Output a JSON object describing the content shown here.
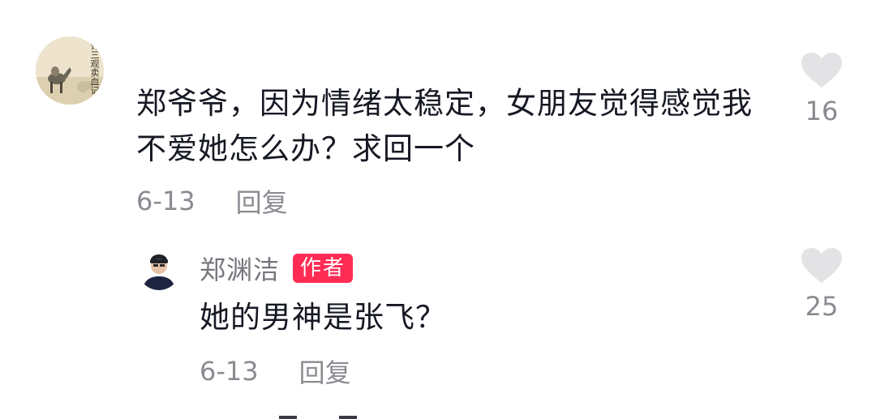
{
  "comment": {
    "avatar_icon": "painted-avatar-icon",
    "avatar_seal_text": "许三观卖血记",
    "text": "郑爷爷，因为情绪太稳定，女朋友觉得感觉我不爱她怎么办？求回一个",
    "date": "6-13",
    "reply_label": "回复",
    "like_icon": "heart-icon",
    "like_count": "16"
  },
  "reply": {
    "avatar_icon": "person-avatar-icon",
    "author": "郑渊洁",
    "badge": "作者",
    "text": "她的男神是张飞？",
    "date": "6-13",
    "reply_label": "回复",
    "like_icon": "heart-icon",
    "like_count": "25"
  },
  "colors": {
    "text": "#161823",
    "muted": "#8a8b91",
    "badge": "#fe2c55",
    "heart": "#e3e3e5"
  }
}
